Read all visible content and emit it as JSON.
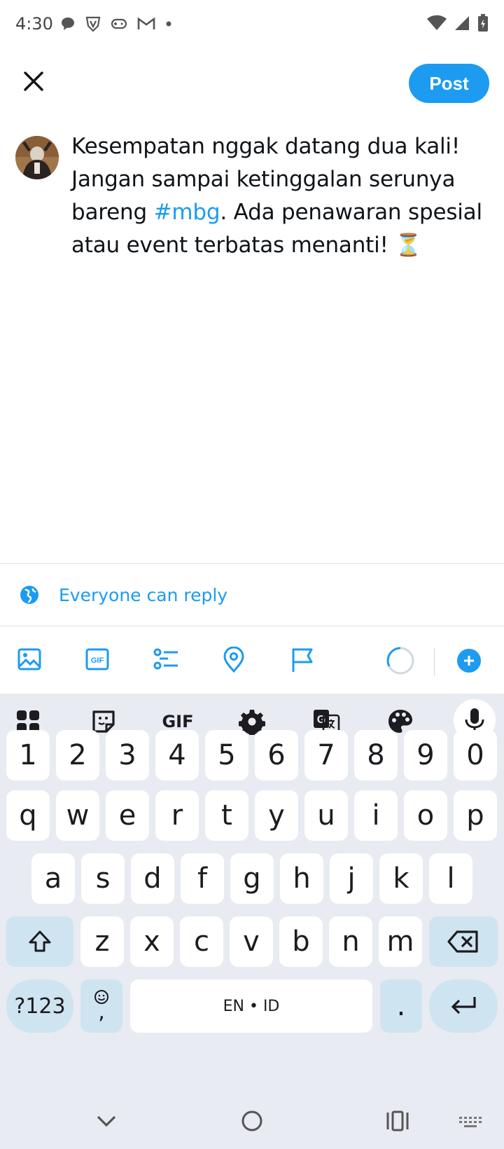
{
  "status_bar": {
    "time": "4:30",
    "left_icons": [
      "chat-bubble-icon",
      "vpn-shield-icon",
      "gamepad-icon",
      "gmail-icon",
      "dot-icon"
    ],
    "right_icons": [
      "wifi-icon",
      "cell-signal-icon",
      "battery-charging-icon"
    ]
  },
  "header": {
    "close_icon": "close-icon",
    "post_label": "Post"
  },
  "composer": {
    "text_part1": "Kesempatan nggak datang dua kali! Jangan sampai ketinggalan serunya bareng ",
    "hashtag": "#mbg",
    "text_part2": ". Ada penawaran spesial atau event terbatas menanti! ",
    "emoji": "⏳"
  },
  "reply_setting": {
    "icon": "globe-icon",
    "label": "Everyone can reply"
  },
  "toolbar": {
    "items": [
      "image-icon",
      "gif-icon",
      "poll-icon",
      "location-icon",
      "flag-icon"
    ],
    "add_icon": "add-thread-icon"
  },
  "keyboard": {
    "tools": [
      "apps-grid-icon",
      "sticker-icon",
      "GIF",
      "settings-icon",
      "translate-icon",
      "palette-icon",
      "mic-icon"
    ],
    "row_numbers": [
      "1",
      "2",
      "3",
      "4",
      "5",
      "6",
      "7",
      "8",
      "9",
      "0"
    ],
    "row1": [
      "q",
      "w",
      "e",
      "r",
      "t",
      "y",
      "u",
      "i",
      "o",
      "p"
    ],
    "row2": [
      "a",
      "s",
      "d",
      "f",
      "g",
      "h",
      "j",
      "k",
      "l"
    ],
    "row3": [
      "z",
      "x",
      "c",
      "v",
      "b",
      "n",
      "m"
    ],
    "symbols_label": "?123",
    "emoji_comma": ",",
    "space_label": "EN • ID",
    "period": ".",
    "accent_color": "#1d9bf0"
  },
  "nav_bar": {
    "items": [
      "hide-keyboard-icon",
      "home-icon",
      "recents-icon",
      "keyboard-switch-icon"
    ]
  }
}
